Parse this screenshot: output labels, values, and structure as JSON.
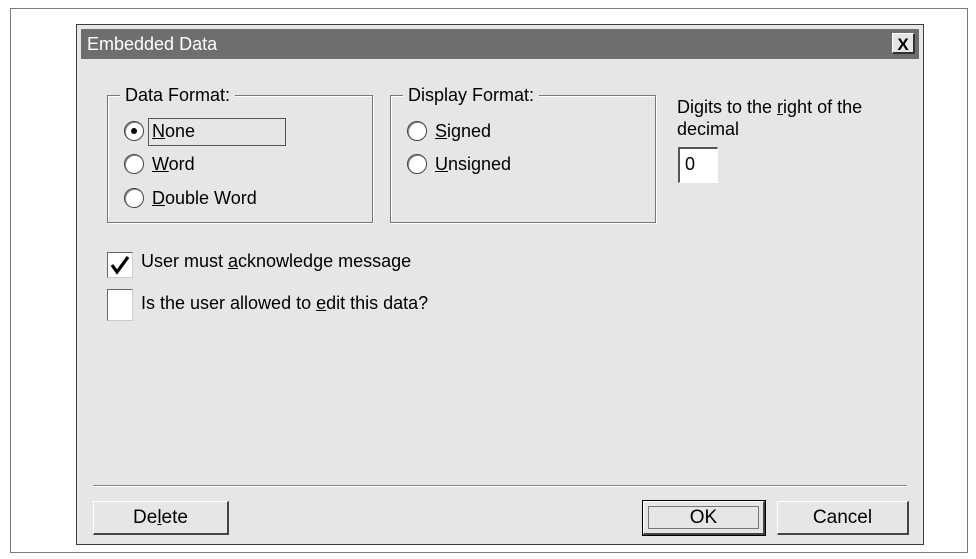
{
  "dialog": {
    "title": "Embedded Data",
    "close_label": "X"
  },
  "data_format": {
    "legend": "Data Format:",
    "options": [
      {
        "mnemonic": "N",
        "rest": "one",
        "selected": true
      },
      {
        "mnemonic": "W",
        "rest": "ord",
        "selected": false
      },
      {
        "mnemonic": "D",
        "rest": "ouble Word",
        "selected": false
      }
    ]
  },
  "display_format": {
    "legend": "Display Format:",
    "options": [
      {
        "mnemonic": "S",
        "rest": "igned",
        "selected": false
      },
      {
        "mnemonic": "U",
        "rest": "nsigned",
        "selected": false
      }
    ]
  },
  "digits": {
    "label_before": "Digits to the ",
    "label_mnemonic": "r",
    "label_after": "ight of the",
    "label_line2": "decimal",
    "value": "0"
  },
  "checkboxes": [
    {
      "before": "User must ",
      "mnemonic": "a",
      "after": "cknowledge message",
      "checked": true
    },
    {
      "before": "Is the user allowed to ",
      "mnemonic": "e",
      "after": "dit this data?",
      "checked": false
    }
  ],
  "buttons": {
    "delete": {
      "before": "De",
      "mnemonic": "l",
      "after": "ete"
    },
    "ok": "OK",
    "cancel": "Cancel"
  }
}
